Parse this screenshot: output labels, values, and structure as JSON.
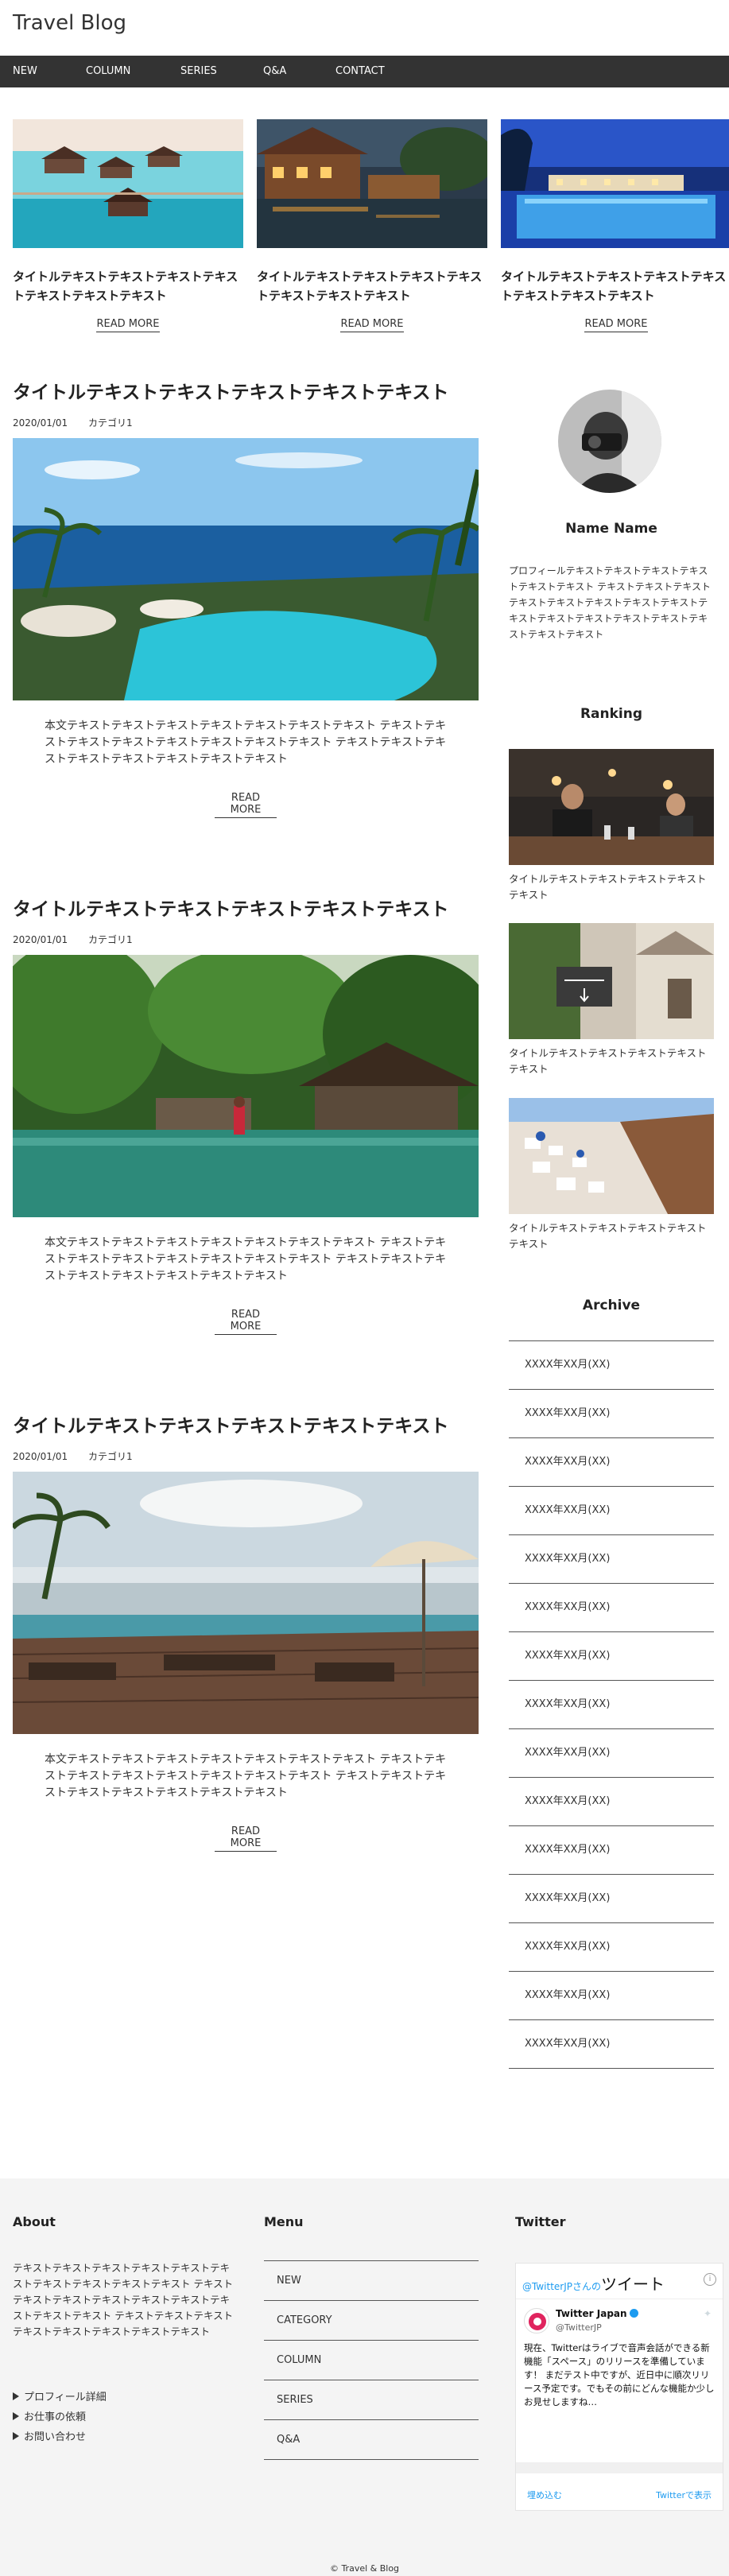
{
  "site": {
    "title": "Travel Blog"
  },
  "nav": [
    "NEW",
    "COLUMN",
    "SERIES",
    "Q&A",
    "CONTACT"
  ],
  "pickups": [
    {
      "title": "タイトルテキストテキストテキストテキストテキストテキストテキスト",
      "more": "READ MORE"
    },
    {
      "title": "タイトルテキストテキストテキストテキストテキストテキストテキスト",
      "more": "READ MORE"
    },
    {
      "title": "タイトルテキストテキストテキストテキストテキストテキストテキスト",
      "more": "READ MORE"
    }
  ],
  "posts": [
    {
      "title": "タイトルテキストテキストテキストテキストテキスト",
      "date": "2020/01/01",
      "category": "カテゴリ1",
      "body": "本文テキストテキストテキストテキストテキストテキストテキスト テキストテキストテキストテキストテキストテキストテキストテキスト テキストテキストテキストテキストテキストテキストテキストテキスト",
      "more": "READ MORE"
    },
    {
      "title": "タイトルテキストテキストテキストテキストテキスト",
      "date": "2020/01/01",
      "category": "カテゴリ1",
      "body": "本文テキストテキストテキストテキストテキストテキストテキスト テキストテキストテキストテキストテキストテキストテキストテキスト テキストテキストテキストテキストテキストテキストテキストテキスト",
      "more": "READ MORE"
    },
    {
      "title": "タイトルテキストテキストテキストテキストテキスト",
      "date": "2020/01/01",
      "category": "カテゴリ1",
      "body": "本文テキストテキストテキストテキストテキストテキストテキスト テキストテキストテキストテキストテキストテキストテキストテキスト テキストテキストテキストテキストテキストテキストテキストテキスト",
      "more": "READ MORE"
    }
  ],
  "sidebar": {
    "name": "Name Name",
    "profile": "プロフィールテキストテキストテキストテキストテキストテキスト テキストテキストテキストテキストテキストテキストテキストテキストテキストテキストテキストテキストテキストテキストテキストテキスト",
    "ranking_heading": "Ranking",
    "ranking": [
      "タイトルテキストテキストテキストテキストテキスト",
      "タイトルテキストテキストテキストテキストテキスト",
      "タイトルテキストテキストテキストテキストテキスト"
    ],
    "archive_heading": "Archive",
    "archive": [
      "XXXX年XX月(XX)",
      "XXXX年XX月(XX)",
      "XXXX年XX月(XX)",
      "XXXX年XX月(XX)",
      "XXXX年XX月(XX)",
      "XXXX年XX月(XX)",
      "XXXX年XX月(XX)",
      "XXXX年XX月(XX)",
      "XXXX年XX月(XX)",
      "XXXX年XX月(XX)",
      "XXXX年XX月(XX)",
      "XXXX年XX月(XX)",
      "XXXX年XX月(XX)",
      "XXXX年XX月(XX)",
      "XXXX年XX月(XX)"
    ]
  },
  "footer": {
    "about_heading": "About",
    "about_text": "テキストテキストテキストテキストテキストテキストテキストテキストテキストテキスト テキストテキストテキストテキストテキストテキストテキストテキストテキスト テキストテキストテキストテキストテキストテキストテキストテキスト",
    "about_links": [
      "プロフィール詳細",
      "お仕事の依頼",
      "お問い合わせ"
    ],
    "menu_heading": "Menu",
    "menu": [
      "NEW",
      "CATEGORY",
      "COLUMN",
      "SERIES",
      "Q&A"
    ],
    "twitter_heading": "Twitter",
    "copyright": "© Travel & Blog"
  },
  "twitter_widget": {
    "header_prefix": "@TwitterJPさんの",
    "header_main": "ツイート",
    "user_name": "Twitter Japan",
    "user_handle": "@TwitterJP",
    "text": "現在、Twitterはライブで音声会話ができる新機能「スペース」のリリースを準備しています！ まだテスト中ですが、近日中に順次リリース予定です。でもその前にどんな機能か少しお見せしますね…",
    "embed": "埋め込む",
    "view": "Twitterで表示"
  }
}
